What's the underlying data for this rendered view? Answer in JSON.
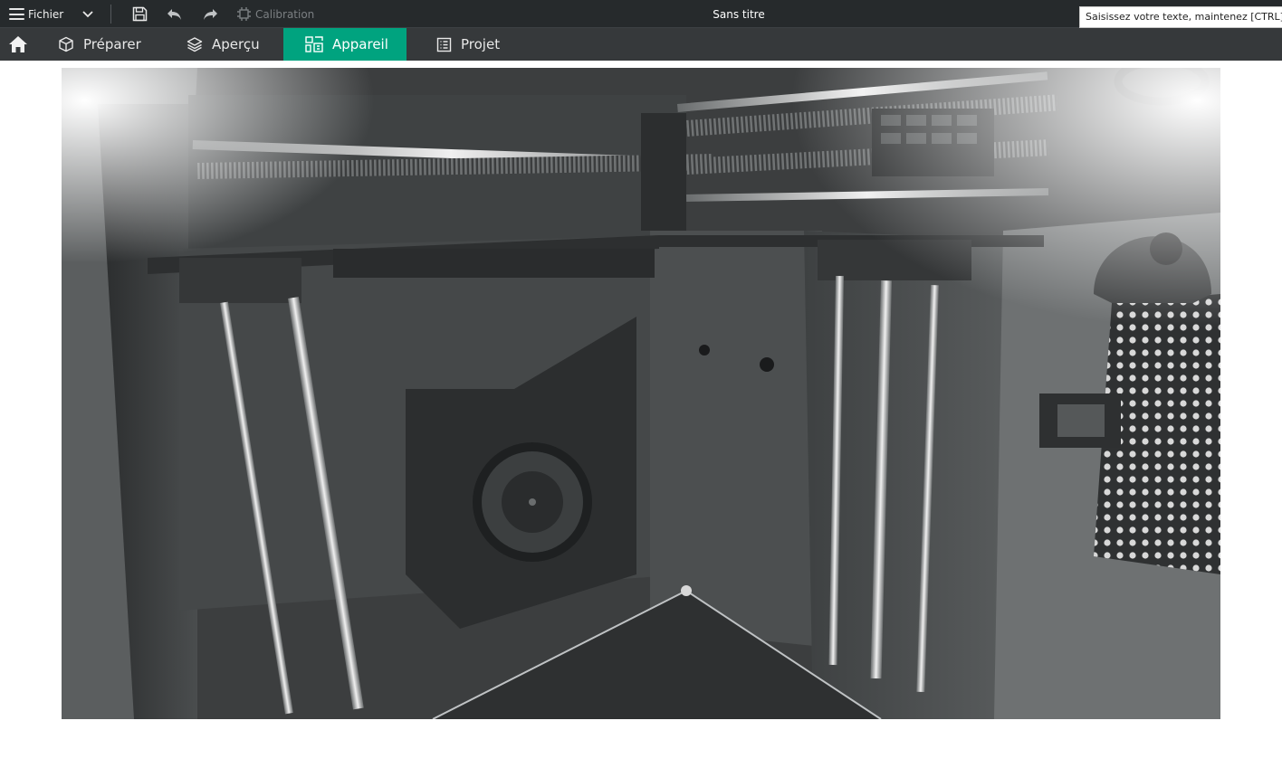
{
  "titlebar": {
    "menu_label": "Fichier",
    "calibration_label": "Calibration",
    "document_title": "Sans titre",
    "tooltip_text": "Saisissez votre texte, maintenez [CTRL] et"
  },
  "tabs": [
    {
      "label": "Préparer",
      "icon": "cube-icon",
      "active": false
    },
    {
      "label": "Aperçu",
      "icon": "layers-icon",
      "active": false
    },
    {
      "label": "Appareil",
      "icon": "device-icon",
      "active": true
    },
    {
      "label": "Projet",
      "icon": "project-icon",
      "active": false
    }
  ],
  "colors": {
    "titlebar_bg": "#262a2c",
    "tabbar_bg": "#36393b",
    "accent": "#00a37f"
  },
  "camera": {
    "content": "printer-chamber-live-view"
  }
}
